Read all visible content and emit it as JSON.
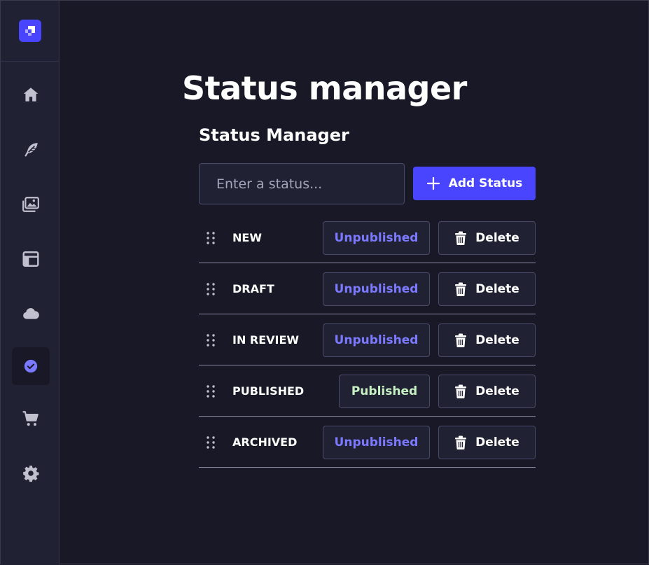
{
  "sidebar": {
    "logo_icon": "logo-icon",
    "items": [
      {
        "name": "home",
        "icon": "home-icon"
      },
      {
        "name": "content",
        "icon": "feather-icon"
      },
      {
        "name": "media",
        "icon": "images-icon"
      },
      {
        "name": "layout",
        "icon": "layout-icon"
      },
      {
        "name": "cloud",
        "icon": "cloud-icon"
      },
      {
        "name": "status",
        "icon": "check-circle-icon",
        "active": true
      },
      {
        "name": "shop",
        "icon": "cart-icon"
      },
      {
        "name": "settings",
        "icon": "gear-icon"
      }
    ]
  },
  "page": {
    "title": "Status manager",
    "section_title": "Status Manager"
  },
  "form": {
    "input_value": "",
    "input_placeholder": "Enter a status...",
    "add_label": "Add Status"
  },
  "statuses": [
    {
      "name": "NEW",
      "state": "Unpublished",
      "delete": "Delete"
    },
    {
      "name": "DRAFT",
      "state": "Unpublished",
      "delete": "Delete"
    },
    {
      "name": "IN REVIEW",
      "state": "Unpublished",
      "delete": "Delete"
    },
    {
      "name": "PUBLISHED",
      "state": "Published",
      "delete": "Delete"
    },
    {
      "name": "ARCHIVED",
      "state": "Unpublished",
      "delete": "Delete"
    }
  ],
  "colors": {
    "accent": "#4945ff",
    "unpublished_text": "#7b79ff",
    "published_text": "#c6f0c2",
    "background": "#181826",
    "surface": "#212134"
  }
}
